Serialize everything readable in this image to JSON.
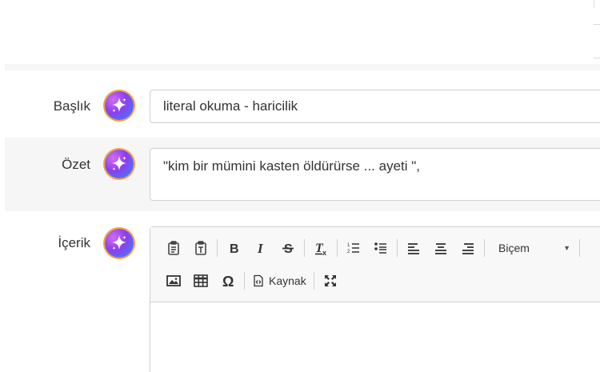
{
  "fields": {
    "title": {
      "label": "Başlık",
      "value": "literal okuma - haricilik"
    },
    "summary": {
      "label": "Özet",
      "value": "\"kim bir mümini kasten öldürürse ... ayeti \","
    },
    "content": {
      "label": "İçerik",
      "value": ""
    }
  },
  "toolbar": {
    "format_label": "Biçem",
    "source_label": "Kaynak"
  },
  "icons": {
    "ai": "sparkles-icon",
    "paste": "paste-icon",
    "paste_text": "paste-text-icon",
    "bold": "bold-icon",
    "italic": "italic-icon",
    "strike": "strikethrough-icon",
    "remove_format": "remove-format-icon",
    "numbered_list": "numbered-list-icon",
    "bulleted_list": "bulleted-list-icon",
    "align_left": "align-left-icon",
    "align_center": "align-center-icon",
    "align_right": "align-right-icon",
    "image": "image-icon",
    "table": "table-icon",
    "special_char": "omega-icon",
    "source": "source-icon",
    "maximize": "maximize-icon"
  },
  "colors": {
    "row_alt_bg": "#f6f6f6",
    "border": "#cfcfcf",
    "ai_ring": "#f3a43a",
    "ai_gradient_start": "#d06cf0",
    "ai_gradient_end": "#36a0f5"
  }
}
